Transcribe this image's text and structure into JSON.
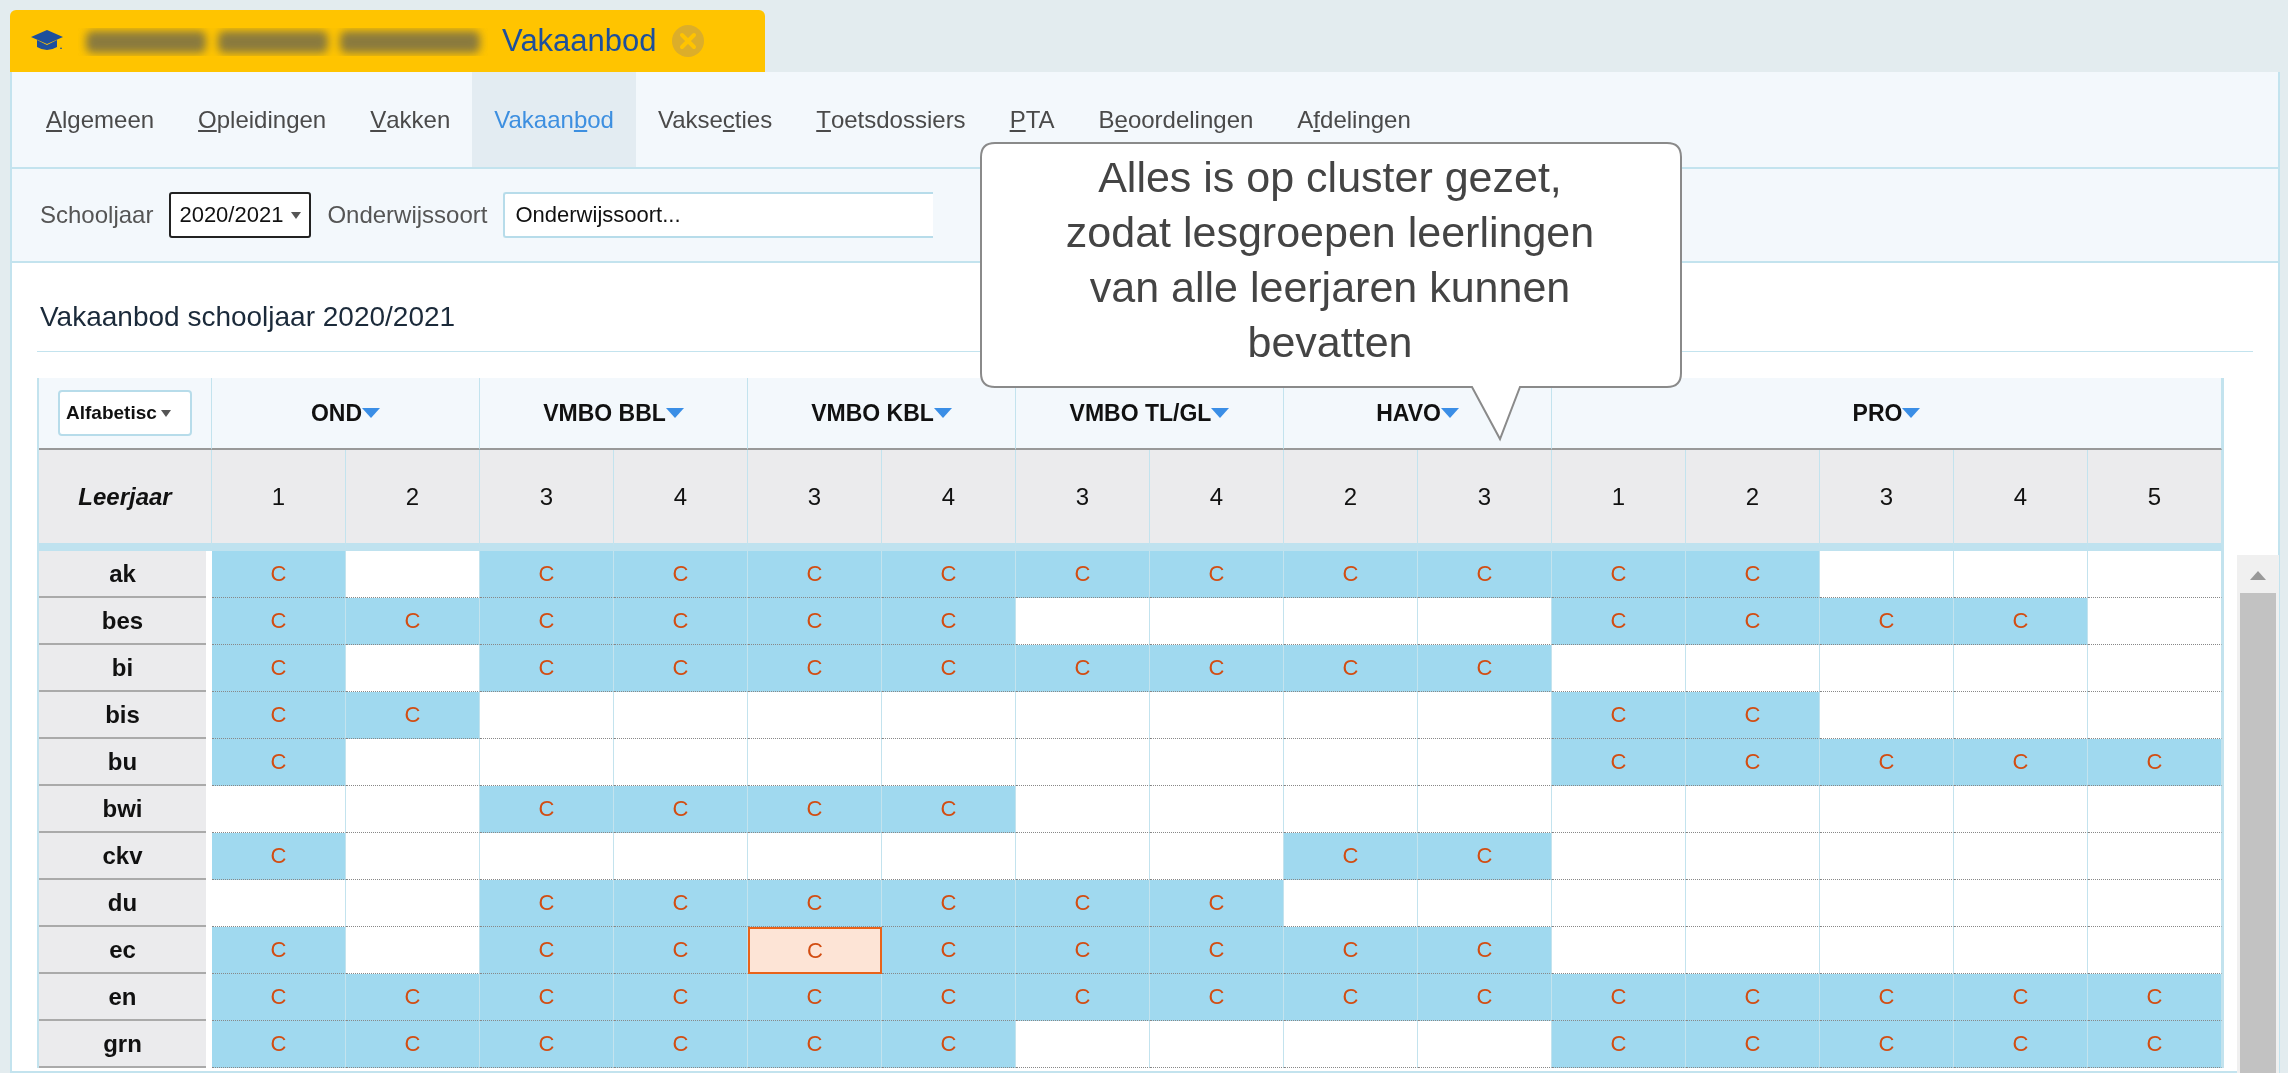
{
  "app_tab": {
    "title": "Vakaanbod"
  },
  "nav_tabs": [
    {
      "key": "A",
      "rest": "lgemeen",
      "selected": false
    },
    {
      "key": "O",
      "rest": "pleidingen",
      "selected": false
    },
    {
      "key": "V",
      "rest": "akken",
      "selected": false
    },
    {
      "lead": "Vakaan",
      "key": "b",
      "rest": "od",
      "selected": true
    },
    {
      "lead": "Vakse",
      "key": "c",
      "rest": "ties",
      "selected": false
    },
    {
      "key": "T",
      "rest": "oetsdossiers",
      "selected": false
    },
    {
      "key": "P",
      "rest": "TA",
      "selected": false
    },
    {
      "lead": "B",
      "key": "e",
      "rest": "oordelingen",
      "selected": false
    },
    {
      "lead": "A",
      "key": "f",
      "rest": "delingen",
      "selected": false
    }
  ],
  "filters": {
    "schooljaar": {
      "label": "Schooljaar",
      "value": "2020/2021"
    },
    "onderwijssoort": {
      "label": "Onderwijssoort",
      "value": "Onderwijssoort..."
    }
  },
  "section_title": "Vakaanbod schooljaar 2020/2021",
  "table": {
    "sort_select": "Alfabetisc",
    "row_header": "Leerjaar",
    "groups": [
      {
        "name": "OND",
        "years": [
          "1",
          "2"
        ]
      },
      {
        "name": "VMBO BBL",
        "years": [
          "3",
          "4"
        ]
      },
      {
        "name": "VMBO KBL",
        "years": [
          "3",
          "4"
        ]
      },
      {
        "name": "VMBO TL/GL",
        "years": [
          "3",
          "4"
        ]
      },
      {
        "name": "HAVO",
        "years": [
          "2",
          "3"
        ]
      },
      {
        "name": "PRO",
        "years": [
          "1",
          "2",
          "3",
          "4",
          "5"
        ]
      }
    ],
    "rows": [
      {
        "subject": "ak",
        "cells": [
          {
            "text": "C",
            "selected": false
          },
          {
            "selected": false
          },
          {
            "text": "C",
            "selected": false
          },
          {
            "text": "C",
            "selected": false
          },
          {
            "text": "C",
            "selected": false
          },
          {
            "text": "C",
            "selected": false
          },
          {
            "text": "C",
            "selected": false
          },
          {
            "text": "C",
            "selected": false
          },
          {
            "text": "C",
            "selected": false
          },
          {
            "text": "C",
            "selected": false
          },
          {
            "text": "C",
            "selected": false
          },
          {
            "text": "C",
            "selected": false
          },
          {
            "selected": false
          },
          {
            "selected": false
          },
          {
            "selected": false
          }
        ]
      },
      {
        "subject": "bes",
        "cells": [
          {
            "text": "C",
            "selected": false
          },
          {
            "text": "C",
            "selected": false
          },
          {
            "text": "C",
            "selected": false
          },
          {
            "text": "C",
            "selected": false
          },
          {
            "text": "C",
            "selected": false
          },
          {
            "text": "C",
            "selected": false
          },
          {
            "selected": false
          },
          {
            "selected": false
          },
          {
            "selected": false
          },
          {
            "selected": false
          },
          {
            "text": "C",
            "selected": false
          },
          {
            "text": "C",
            "selected": false
          },
          {
            "text": "C",
            "selected": false
          },
          {
            "text": "C",
            "selected": false
          },
          {
            "selected": false
          }
        ]
      },
      {
        "subject": "bi",
        "cells": [
          {
            "text": "C",
            "selected": false
          },
          {
            "selected": false
          },
          {
            "text": "C",
            "selected": false
          },
          {
            "text": "C",
            "selected": false
          },
          {
            "text": "C",
            "selected": false
          },
          {
            "text": "C",
            "selected": false
          },
          {
            "text": "C",
            "selected": false
          },
          {
            "text": "C",
            "selected": false
          },
          {
            "text": "C",
            "selected": false
          },
          {
            "text": "C",
            "selected": false
          },
          {
            "selected": false
          },
          {
            "selected": false
          },
          {
            "selected": false
          },
          {
            "selected": false
          },
          {
            "selected": false
          }
        ]
      },
      {
        "subject": "bis",
        "cells": [
          {
            "text": "C",
            "selected": false
          },
          {
            "text": "C",
            "selected": false
          },
          {
            "selected": false
          },
          {
            "selected": false
          },
          {
            "selected": false
          },
          {
            "selected": false
          },
          {
            "selected": false
          },
          {
            "selected": false
          },
          {
            "selected": false
          },
          {
            "selected": false
          },
          {
            "text": "C",
            "selected": false
          },
          {
            "text": "C",
            "selected": false
          },
          {
            "selected": false
          },
          {
            "selected": false
          },
          {
            "selected": false
          }
        ]
      },
      {
        "subject": "bu",
        "cells": [
          {
            "text": "C",
            "selected": false
          },
          {
            "selected": false
          },
          {
            "selected": false
          },
          {
            "selected": false
          },
          {
            "selected": false
          },
          {
            "selected": false
          },
          {
            "selected": false
          },
          {
            "selected": false
          },
          {
            "selected": false
          },
          {
            "selected": false
          },
          {
            "text": "C",
            "selected": false
          },
          {
            "text": "C",
            "selected": false
          },
          {
            "text": "C",
            "selected": false
          },
          {
            "text": "C",
            "selected": false
          },
          {
            "text": "C",
            "selected": false
          }
        ]
      },
      {
        "subject": "bwi",
        "cells": [
          {
            "selected": false
          },
          {
            "selected": false
          },
          {
            "text": "C",
            "selected": false
          },
          {
            "text": "C",
            "selected": false
          },
          {
            "text": "C",
            "selected": false
          },
          {
            "text": "C",
            "selected": false
          },
          {
            "selected": false
          },
          {
            "selected": false
          },
          {
            "selected": false
          },
          {
            "selected": false
          },
          {
            "selected": false
          },
          {
            "selected": false
          },
          {
            "selected": false
          },
          {
            "selected": false
          },
          {
            "selected": false
          }
        ]
      },
      {
        "subject": "ckv",
        "cells": [
          {
            "text": "C",
            "selected": false
          },
          {
            "selected": false
          },
          {
            "selected": false
          },
          {
            "selected": false
          },
          {
            "selected": false
          },
          {
            "selected": false
          },
          {
            "selected": false
          },
          {
            "selected": false
          },
          {
            "text": "C",
            "selected": false
          },
          {
            "text": "C",
            "selected": false
          },
          {
            "selected": false
          },
          {
            "selected": false
          },
          {
            "selected": false
          },
          {
            "selected": false
          },
          {
            "selected": false
          }
        ]
      },
      {
        "subject": "du",
        "cells": [
          {
            "selected": false
          },
          {
            "selected": false
          },
          {
            "text": "C",
            "selected": false
          },
          {
            "text": "C",
            "selected": false
          },
          {
            "text": "C",
            "selected": false
          },
          {
            "text": "C",
            "selected": false
          },
          {
            "text": "C",
            "selected": false
          },
          {
            "text": "C",
            "selected": false
          },
          {
            "selected": false
          },
          {
            "selected": false
          },
          {
            "selected": false
          },
          {
            "selected": false
          },
          {
            "selected": false
          },
          {
            "selected": false
          },
          {
            "selected": false
          }
        ]
      },
      {
        "subject": "ec",
        "cells": [
          {
            "text": "C",
            "selected": false
          },
          {
            "selected": false
          },
          {
            "text": "C",
            "selected": false
          },
          {
            "text": "C",
            "selected": false
          },
          {
            "text": "C",
            "selected": true
          },
          {
            "text": "C",
            "selected": false
          },
          {
            "text": "C",
            "selected": false
          },
          {
            "text": "C",
            "selected": false
          },
          {
            "text": "C",
            "selected": false
          },
          {
            "text": "C",
            "selected": false
          },
          {
            "selected": false
          },
          {
            "selected": false
          },
          {
            "selected": false
          },
          {
            "selected": false
          },
          {
            "selected": false
          }
        ]
      },
      {
        "subject": "en",
        "cells": [
          {
            "text": "C",
            "selected": false
          },
          {
            "text": "C",
            "selected": false
          },
          {
            "text": "C",
            "selected": false
          },
          {
            "text": "C",
            "selected": false
          },
          {
            "text": "C",
            "selected": false
          },
          {
            "text": "C",
            "selected": false
          },
          {
            "text": "C",
            "selected": false
          },
          {
            "text": "C",
            "selected": false
          },
          {
            "text": "C",
            "selected": false
          },
          {
            "text": "C",
            "selected": false
          },
          {
            "text": "C",
            "selected": false
          },
          {
            "text": "C",
            "selected": false
          },
          {
            "text": "C",
            "selected": false
          },
          {
            "text": "C",
            "selected": false
          },
          {
            "text": "C",
            "selected": false
          }
        ]
      },
      {
        "subject": "grn",
        "cells": [
          {
            "text": "C",
            "selected": false
          },
          {
            "text": "C",
            "selected": false
          },
          {
            "text": "C",
            "selected": false
          },
          {
            "text": "C",
            "selected": false
          },
          {
            "text": "C",
            "selected": false
          },
          {
            "text": "C",
            "selected": false
          },
          {
            "selected": false
          },
          {
            "selected": false
          },
          {
            "selected": false
          },
          {
            "selected": false
          },
          {
            "text": "C",
            "selected": false
          },
          {
            "text": "C",
            "selected": false
          },
          {
            "text": "C",
            "selected": false
          },
          {
            "text": "C",
            "selected": false
          },
          {
            "text": "C",
            "selected": false
          }
        ]
      }
    ]
  },
  "tooltip": {
    "text": "Alles is op cluster gezet, zodat lesgroepen leerlingen van alle leerjaren kunnen bevatten"
  }
}
